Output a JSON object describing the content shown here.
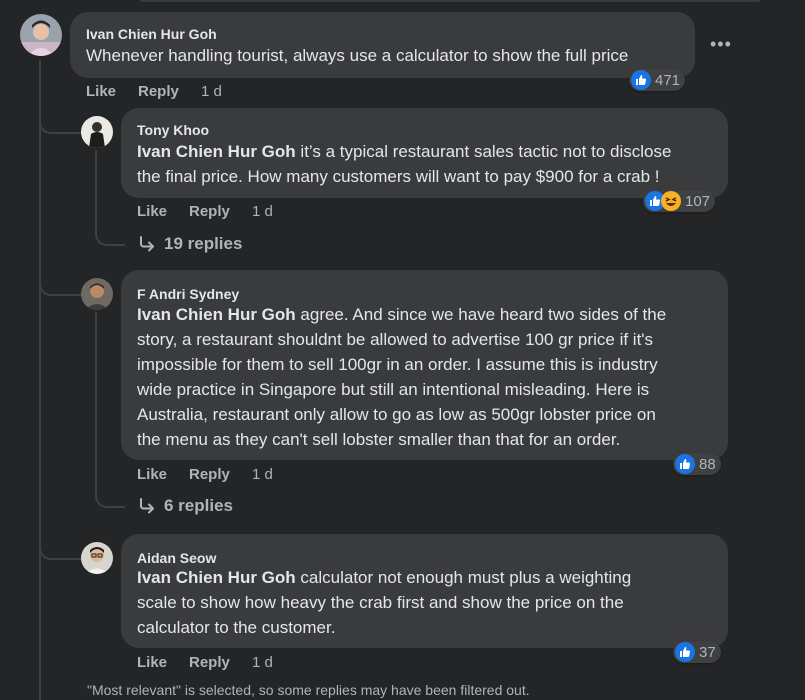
{
  "comments": [
    {
      "author": "Ivan Chien Hur Goh",
      "text": "Whenever handling tourist, always use a calculator to show the full price",
      "reaction_count": "471",
      "reactions": [
        "like-icon"
      ],
      "time": "1 d"
    }
  ],
  "replies": [
    {
      "author": "Tony Khoo",
      "mention": "Ivan Chien Hur Goh",
      "text_line1": " it’s a typical restaurant sales tactic not to disclose",
      "text_line2": "the final price. How many customers will want to pay $900 for a crab !",
      "reaction_count": "107",
      "reactions": [
        "like-icon",
        "haha-icon"
      ],
      "time": "1 d",
      "more_replies": "19 replies"
    },
    {
      "author": "F Andri Sydney",
      "mention": "Ivan Chien Hur Goh",
      "text_line1": " agree. And since we have heard two sides of the",
      "text_line2": "story, a restaurant shouldnt be allowed to advertise 100 gr price if it's",
      "text_line3": "impossible for them to sell 100gr in an order. I assume this is industry",
      "text_line4": "wide practice in Singapore but still an intentional misleading. Here is",
      "text_line5": "Australia, restaurant only allow to go as low as 500gr lobster price on",
      "text_line6": "the menu as they can't sell lobster smaller than that for an order.",
      "reaction_count": "88",
      "reactions": [
        "like-icon"
      ],
      "time": "1 d",
      "more_replies": "6 replies"
    },
    {
      "author": "Aidan Seow",
      "mention": "Ivan Chien Hur Goh",
      "text_line1": " calculator not enough must plus a weighting",
      "text_line2": "scale to show how heavy the crab first and show the price on the",
      "text_line3": "calculator to the customer.",
      "reaction_count": "37",
      "reactions": [
        "like-icon"
      ],
      "time": "1 d"
    }
  ],
  "actions": {
    "like": "Like",
    "reply": "Reply"
  },
  "more_options": "•••",
  "footer_note": "\"Most relevant\" is selected, so some replies may have been filtered out.",
  "colors": {
    "background": "#242526",
    "bubble": "#3a3b3c",
    "like_blue": "#1b74e4",
    "haha_yellow": "#f7b125",
    "muted": "#b0b3b8"
  }
}
